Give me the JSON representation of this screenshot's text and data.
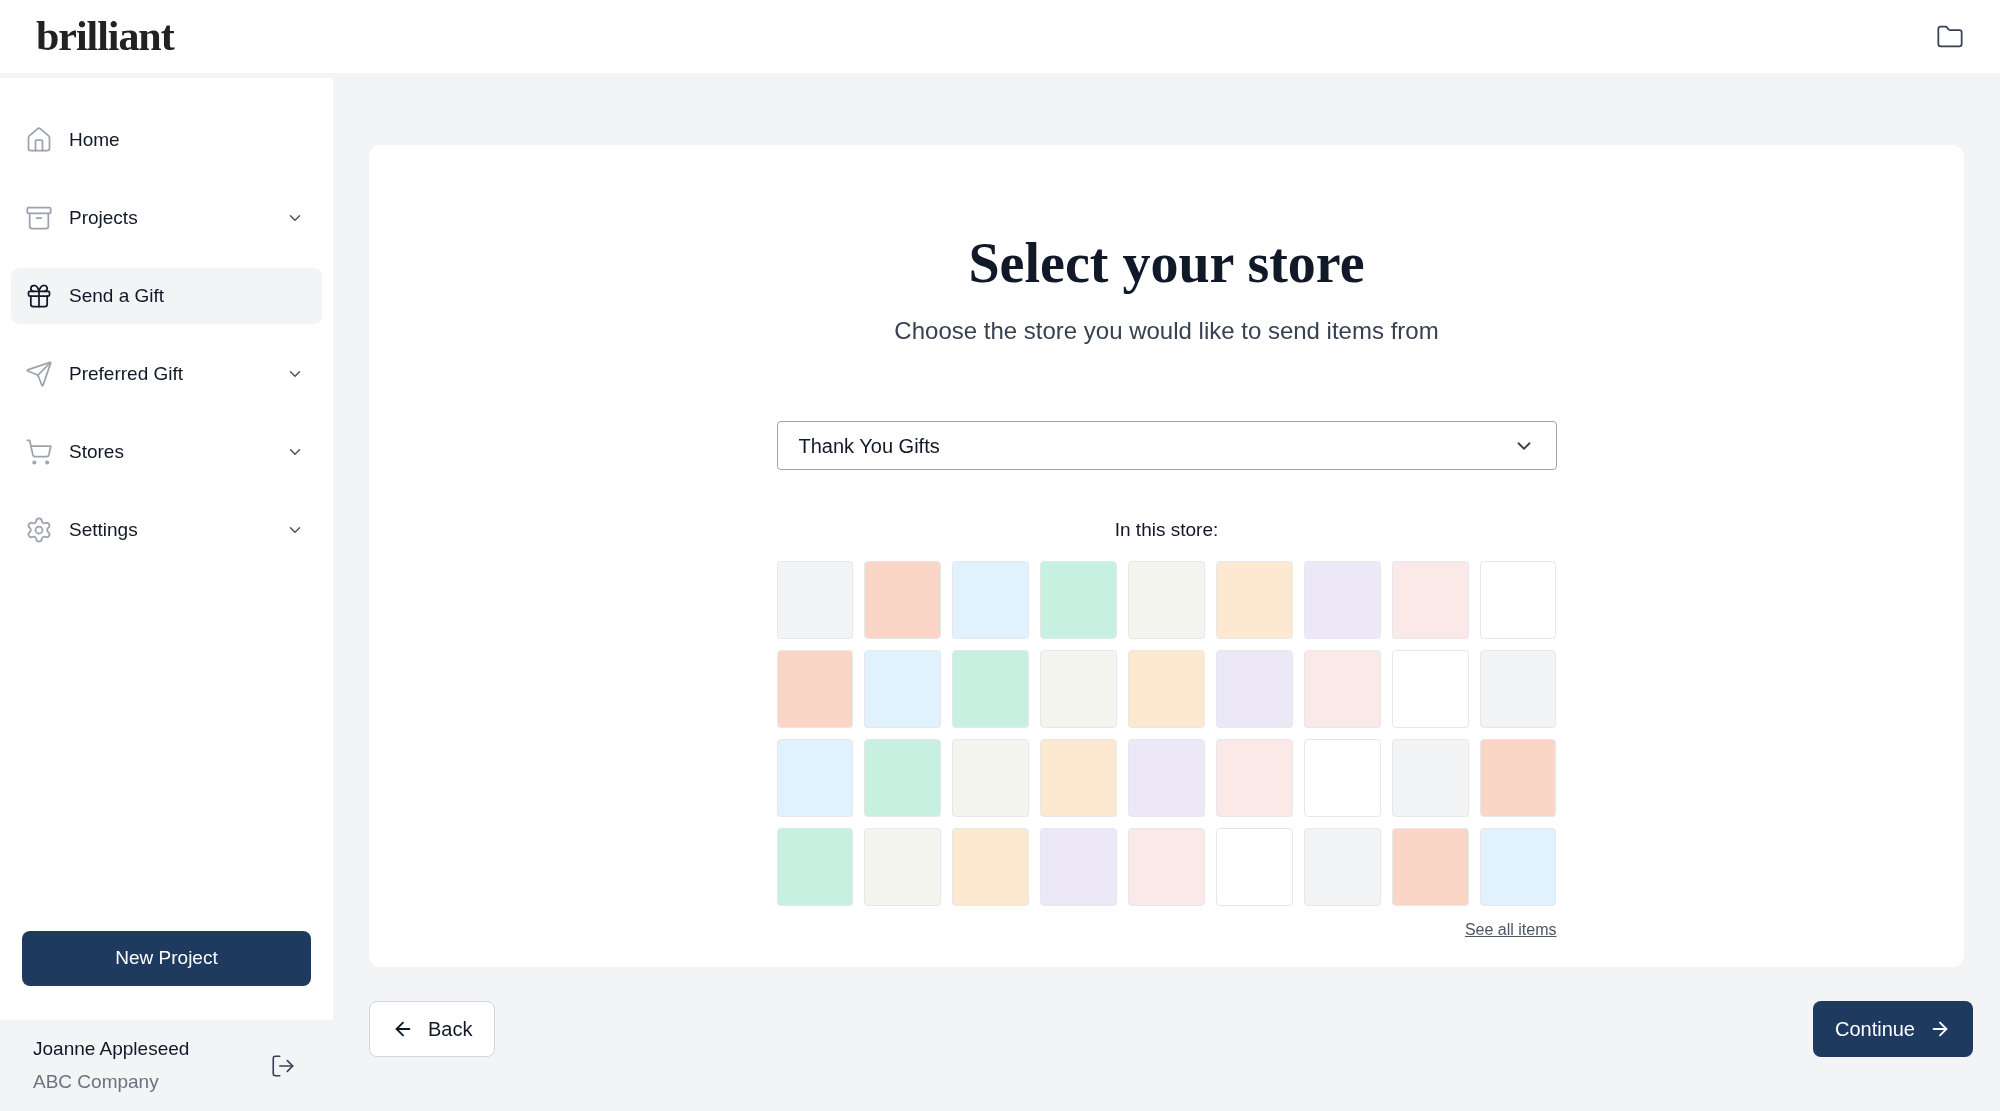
{
  "header": {
    "logo": "brilliant"
  },
  "sidebar": {
    "items": [
      {
        "label": "Home",
        "kind": "home",
        "selected": false,
        "expandable": false
      },
      {
        "label": "Projects",
        "kind": "archive",
        "selected": false,
        "expandable": true
      },
      {
        "label": "Send a Gift",
        "kind": "gift",
        "selected": true,
        "expandable": false
      },
      {
        "label": "Preferred Gift",
        "kind": "send",
        "selected": false,
        "expandable": true
      },
      {
        "label": "Stores",
        "kind": "cart",
        "selected": false,
        "expandable": true
      },
      {
        "label": "Settings",
        "kind": "settings",
        "selected": false,
        "expandable": true
      }
    ],
    "new_project_button": "New Project",
    "user": {
      "name": "Joanne Appleseed",
      "company": "ABC Company"
    }
  },
  "main": {
    "title": "Select your store",
    "subtitle": "Choose the store you would like to send items from",
    "store_select": {
      "value": "Thank You Gifts"
    },
    "items_label": "In this store:",
    "tiles": [
      {
        "color": "#f3f4f6"
      },
      {
        "color": "#fbd5c5"
      },
      {
        "color": "#e0f2fe"
      },
      {
        "color": "#c6f0e0"
      },
      {
        "color": "#f5f5f0"
      },
      {
        "color": "#fde9d2"
      },
      {
        "color": "#ede8f7"
      },
      {
        "color": "#fbe9e7"
      },
      {
        "color": "#ffffff"
      },
      {
        "color": "#fbd5c5"
      },
      {
        "color": "#e0f2fe"
      },
      {
        "color": "#c6f0e0"
      },
      {
        "color": "#f5f5f0"
      },
      {
        "color": "#fde9d2"
      },
      {
        "color": "#ede8f7"
      },
      {
        "color": "#fbe9e7"
      },
      {
        "color": "#ffffff"
      },
      {
        "color": "#f3f4f6"
      },
      {
        "color": "#e0f2fe"
      },
      {
        "color": "#c6f0e0"
      },
      {
        "color": "#f5f5f0"
      },
      {
        "color": "#fde9d2"
      },
      {
        "color": "#ede8f7"
      },
      {
        "color": "#fbe9e7"
      },
      {
        "color": "#ffffff"
      },
      {
        "color": "#f3f4f6"
      },
      {
        "color": "#fbd5c5"
      },
      {
        "color": "#c6f0e0"
      },
      {
        "color": "#f5f5f0"
      },
      {
        "color": "#fde9d2"
      },
      {
        "color": "#ede8f7"
      },
      {
        "color": "#fbe9e7"
      },
      {
        "color": "#ffffff"
      },
      {
        "color": "#f3f4f6"
      },
      {
        "color": "#fbd5c5"
      },
      {
        "color": "#e0f2fe"
      }
    ],
    "see_all_link": "See all items"
  },
  "footer": {
    "back_button": "Back",
    "continue_button": "Continue"
  }
}
